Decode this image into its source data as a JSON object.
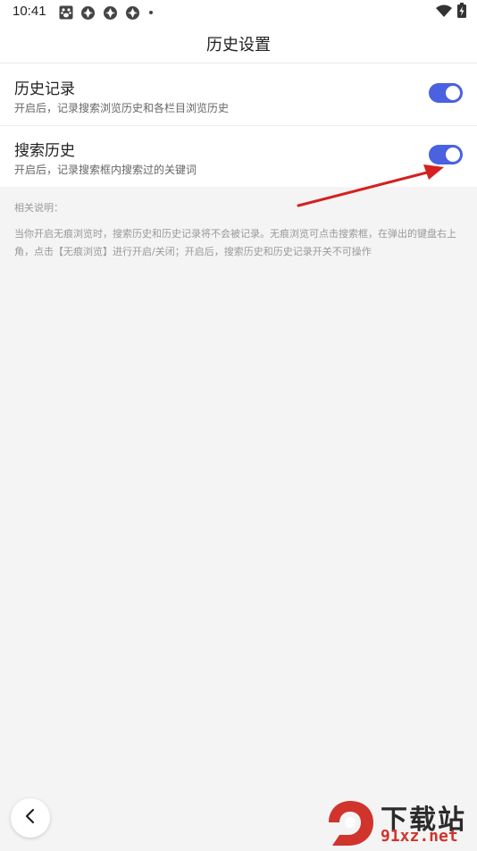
{
  "status_bar": {
    "time": "10:41",
    "left_icons": [
      "baidu-paw-icon",
      "app-icon",
      "app-icon",
      "app-icon",
      "dot-icon"
    ],
    "right_icons": [
      "wifi-icon",
      "battery-charging-icon"
    ]
  },
  "header": {
    "title": "历史设置"
  },
  "settings": [
    {
      "title": "历史记录",
      "description": "开启后，记录搜索浏览历史和各栏目浏览历史",
      "enabled": true
    },
    {
      "title": "搜索历史",
      "description": "开启后，记录搜索框内搜索过的关键词",
      "enabled": true
    }
  ],
  "notes": {
    "heading": "相关说明：",
    "line1": "当你开启无痕浏览时，搜索历史和历史记录将不会被记录。无痕浏览可点击搜索框，在弹出的键盘右上",
    "line2": "角，点击【无痕浏览】进行开启/关闭；开启后，搜索历史和历史记录开关不可操作"
  },
  "watermark": {
    "logo_text": "9",
    "title": "下载站",
    "site": "91xz.net"
  },
  "colors": {
    "accent": "#4a61e0",
    "annotation": "#d62020",
    "background": "#f4f4f4"
  }
}
